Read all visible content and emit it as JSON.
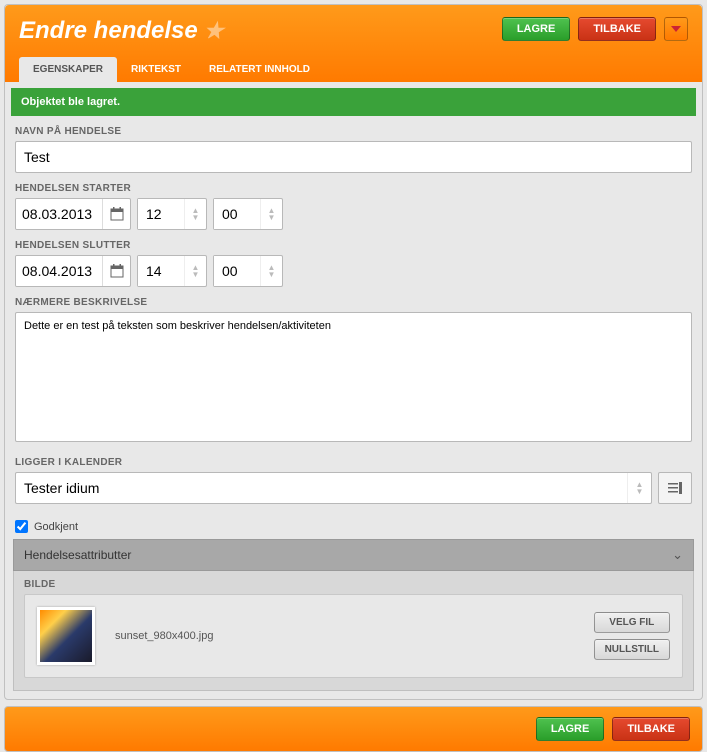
{
  "header": {
    "title": "Endre hendelse",
    "save": "LAGRE",
    "back": "TILBAKE"
  },
  "tabs": [
    {
      "label": "EGENSKAPER",
      "active": true
    },
    {
      "label": "RIKTEKST",
      "active": false
    },
    {
      "label": "RELATERT INNHOLD",
      "active": false
    }
  ],
  "banner": "Objektet ble lagret.",
  "form": {
    "name_label": "NAVN PÅ HENDELSE",
    "name_value": "Test",
    "start_label": "HENDELSEN STARTER",
    "start_date": "08.03.2013",
    "start_hour": "12",
    "start_min": "00",
    "end_label": "HENDELSEN SLUTTER",
    "end_date": "08.04.2013",
    "end_hour": "14",
    "end_min": "00",
    "desc_label": "NÆRMERE BESKRIVELSE",
    "desc_value": "Dette er en test på teksten som beskriver hendelsen/aktiviteten",
    "cal_label": "LIGGER I KALENDER",
    "cal_value": "Tester idium",
    "approved_label": "Godkjent",
    "approved_checked": true
  },
  "accordion": {
    "title": "Hendelsesattributter",
    "image_label": "BILDE",
    "filename": "sunset_980x400.jpg",
    "choose": "VELG FIL",
    "reset": "NULLSTILL"
  },
  "footer": {
    "save": "LAGRE",
    "back": "TILBAKE"
  }
}
